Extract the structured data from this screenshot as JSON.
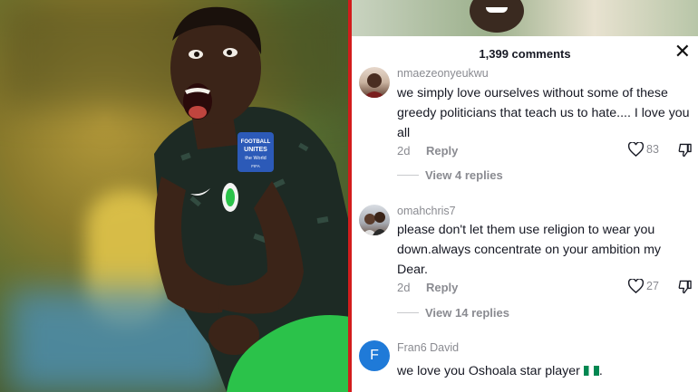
{
  "header": {
    "comment_count": "1,399 comments",
    "close_glyph": "✕"
  },
  "comments": [
    {
      "username": "nmaezeonyeukwu",
      "text": "we simply love ourselves without some of these greedy politicians that teach us to hate.... I love you all",
      "age": "2d",
      "reply_label": "Reply",
      "likes": "83",
      "view_replies": "View 4 replies"
    },
    {
      "username": "omahchris7",
      "text": "please don't let them use religion to wear you down.always concentrate on your ambition my Dear.",
      "age": "2d",
      "reply_label": "Reply",
      "likes": "27",
      "view_replies": "View 14 replies"
    },
    {
      "username": "Fran6 David",
      "avatar_letter": "F",
      "text": "we love you Oshoala star player",
      "avatar_color": "#1f7ad8"
    }
  ],
  "colors": {
    "divider": "#d21c1c",
    "jersey": "#1d2a24",
    "shorts": "#2bc24a"
  },
  "photo": {
    "badge_line1": "FOOTBALL",
    "badge_line2": "UNITES",
    "badge_line3": "the World",
    "badge_line4": "FIFA"
  }
}
